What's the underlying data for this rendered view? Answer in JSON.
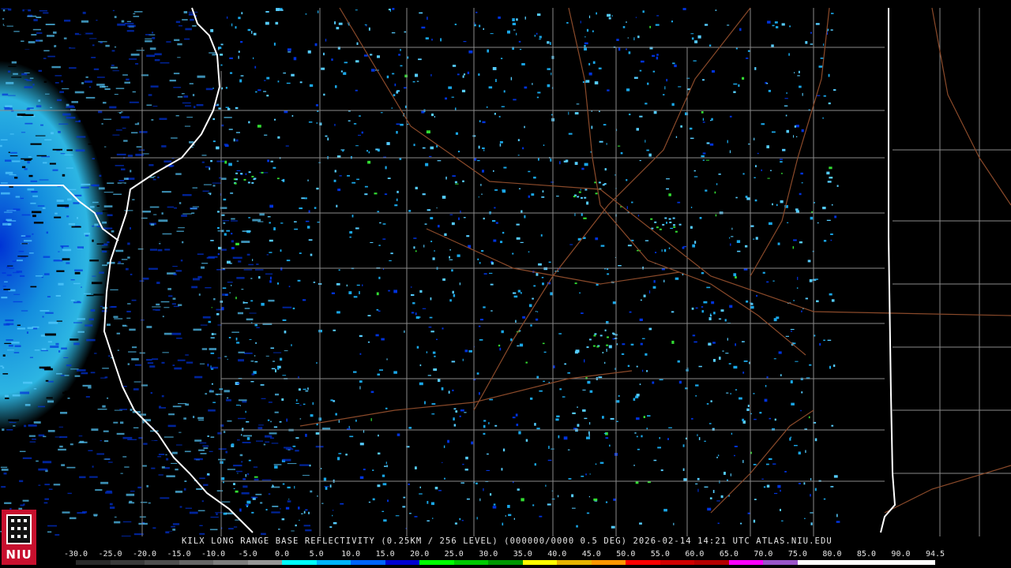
{
  "product_title": "KILX LONG RANGE BASE REFLECTIVITY (0.25KM / 256 LEVEL) (000000/0000 0.5 DEG) 2026-02-14 14:21 UTC  ATLAS.NIU.EDU",
  "logo": {
    "text": "NIU",
    "color": "#c8102e"
  },
  "scale": {
    "labels": [
      "-30.0",
      "-25.0",
      "-20.0",
      "-15.0",
      "-10.0",
      "-5.0",
      "0.0",
      "5.0",
      "10.0",
      "15.0",
      "20.0",
      "25.0",
      "30.0",
      "35.0",
      "40.0",
      "45.0",
      "50.0",
      "55.0",
      "60.0",
      "65.0",
      "70.0",
      "75.0",
      "80.0",
      "85.0",
      "90.0",
      "94.5"
    ],
    "colors": [
      "#2a2a2a",
      "#3a3a3a",
      "#4e4e4e",
      "#666666",
      "#7d7d7d",
      "#969696",
      "#00ffff",
      "#00b4ff",
      "#0064ff",
      "#0000d0",
      "#00ff00",
      "#00c800",
      "#009600",
      "#ffff00",
      "#e6b400",
      "#ff9600",
      "#ff0000",
      "#d00000",
      "#b40000",
      "#ff00ff",
      "#9a55c9",
      "#ffffff",
      "#ffffff",
      "#ffffff",
      "#ffffff"
    ]
  },
  "map_colors": {
    "background": "#000000",
    "county_lines": "#8a8a8a",
    "state_lines": "#ffffff",
    "roads": "#8b4a2a",
    "echo_light": "#55ccff",
    "echo_mid": "#1aa7e8",
    "echo_deep": "#0033dd",
    "echo_green": "#33dd33"
  }
}
